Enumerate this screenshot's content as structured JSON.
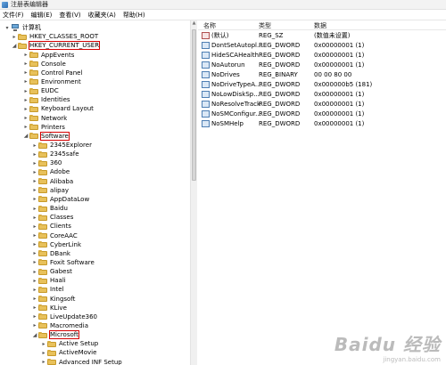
{
  "window": {
    "title": "注册表编辑器"
  },
  "menu": [
    "文件(F)",
    "编辑(E)",
    "查看(V)",
    "收藏夹(A)",
    "帮助(H)"
  ],
  "tree": {
    "root": "计算机",
    "hkcr": "HKEY_CLASSES_ROOT",
    "hkcu": "HKEY_CURRENT_USER",
    "hkcu_children_before": [
      "AppEvents",
      "Console",
      "Control Panel",
      "Environment",
      "EUDC",
      "Identities",
      "Keyboard Layout",
      "Network",
      "Printers"
    ],
    "software": "Software",
    "software_children": [
      "2345Explorer",
      "2345safe",
      "360",
      "Adobe",
      "Alibaba",
      "alipay",
      "AppDataLow",
      "Baidu",
      "Classes",
      "Clients",
      "CoreAAC",
      "CyberLink",
      "DBank",
      "Foxit Software",
      "Gabest",
      "Haali",
      "Intel",
      "Kingsoft",
      "KLive",
      "LiveUpdate360",
      "Macromedia"
    ],
    "microsoft": "Microsoft",
    "microsoft_children": [
      "Active Setup",
      "ActiveMovie",
      "Advanced INF Setup"
    ]
  },
  "values": {
    "headers": {
      "name": "名称",
      "type": "类型",
      "data": "数据"
    },
    "rows": [
      {
        "name": "(默认)",
        "type": "REG_SZ",
        "data": "(数值未设置)",
        "kind": "sz"
      },
      {
        "name": "DontSetAutopl...",
        "type": "REG_DWORD",
        "data": "0x00000001 (1)",
        "kind": "bin"
      },
      {
        "name": "HideSCAHealth",
        "type": "REG_DWORD",
        "data": "0x00000001 (1)",
        "kind": "bin"
      },
      {
        "name": "NoAutorun",
        "type": "REG_DWORD",
        "data": "0x00000001 (1)",
        "kind": "bin"
      },
      {
        "name": "NoDrives",
        "type": "REG_BINARY",
        "data": "00 00 80 00",
        "kind": "bin"
      },
      {
        "name": "NoDriveTypeA...",
        "type": "REG_DWORD",
        "data": "0x000000b5 (181)",
        "kind": "bin"
      },
      {
        "name": "NoLowDiskSp...",
        "type": "REG_DWORD",
        "data": "0x00000001 (1)",
        "kind": "bin"
      },
      {
        "name": "NoResolveTrack",
        "type": "REG_DWORD",
        "data": "0x00000001 (1)",
        "kind": "bin"
      },
      {
        "name": "NoSMConfigur...",
        "type": "REG_DWORD",
        "data": "0x00000001 (1)",
        "kind": "bin"
      },
      {
        "name": "NoSMHelp",
        "type": "REG_DWORD",
        "data": "0x00000001 (1)",
        "kind": "bin"
      }
    ]
  },
  "watermark": {
    "main": "Baidu 经验",
    "sub": "jingyan.baidu.com"
  }
}
